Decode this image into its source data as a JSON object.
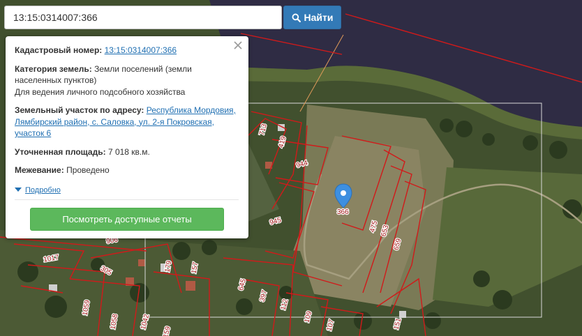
{
  "search": {
    "value": "13:15:0314007:366",
    "button_label": "Найти"
  },
  "popup": {
    "cadastral_label": "Кадастровый номер:",
    "cadastral_value": "13:15:0314007:366",
    "category_label": "Категория земель:",
    "category_value": "Земли поселений (земли населенных пунктов)",
    "category_use": "Для ведения личного подсобного хозяйства",
    "address_label": "Земельный участок по адресу:",
    "address_value": "Республика Мордовия, Лямбирский район, с. Саловка, ул. 2-я Покровская, участок 6",
    "area_label": "Уточненная площадь:",
    "area_value": "7 018 кв.м.",
    "survey_label": "Межевание:",
    "survey_value": "Проведено",
    "details_link": "Подробно",
    "reports_button": "Посмотреть доступные отчеты"
  },
  "map": {
    "marker_label": "366",
    "parcel_labels": [
      "713",
      "419",
      "944",
      "945",
      "475",
      "653",
      "659",
      "1017",
      "906",
      "305",
      "179",
      "157",
      "645",
      "397",
      "112",
      "109",
      "107",
      "151",
      "1059",
      "1058",
      "1042",
      "159"
    ]
  },
  "colors": {
    "search_button": "#337ab7",
    "reports_button": "#5cb85c",
    "marker": "#3d8fe0",
    "parcel_border": "#d11a1a"
  }
}
